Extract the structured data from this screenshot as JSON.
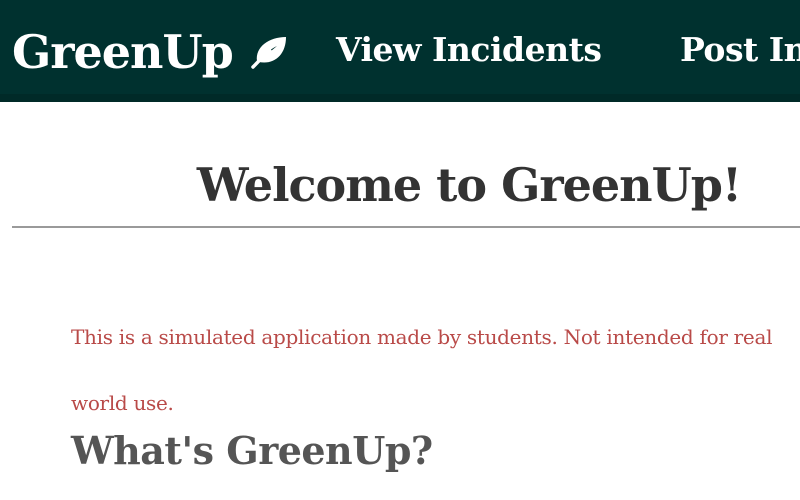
{
  "navbar": {
    "brand": "GreenUp",
    "brand_icon": "leaf-icon",
    "links": [
      {
        "label": "View Incidents"
      },
      {
        "label": "Post Incident"
      }
    ],
    "colors": {
      "background": "#00312f",
      "text": "#ffffff"
    }
  },
  "main": {
    "title": "Welcome to GreenUp!",
    "disclaimer": "This is a simulated application made by students. Not intended for real world use.",
    "section_heading": "What's GreenUp?",
    "colors": {
      "title": "#333333",
      "disclaimer": "#b94a48",
      "heading": "#555555"
    }
  }
}
